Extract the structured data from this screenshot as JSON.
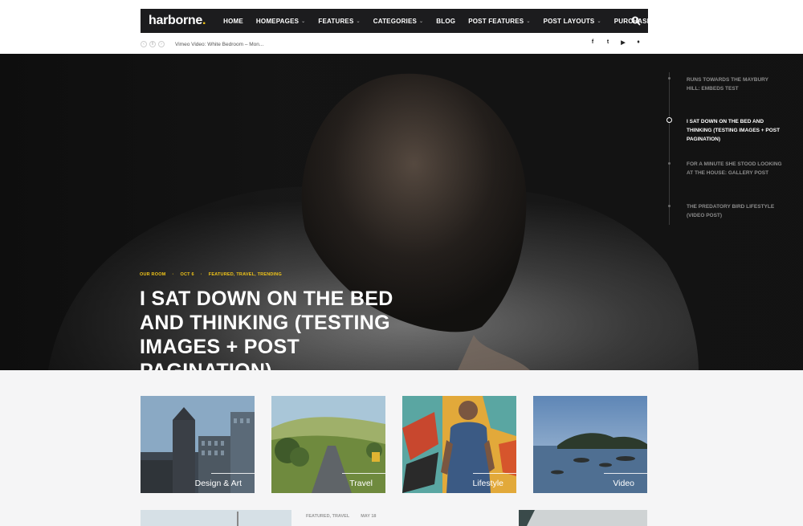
{
  "brand": {
    "name": "harborne",
    "dot": ".",
    "accent": "#f0c419"
  },
  "nav": {
    "items": [
      {
        "label": "HOME",
        "dropdown": false
      },
      {
        "label": "HOMEPAGES",
        "dropdown": true
      },
      {
        "label": "FEATURES",
        "dropdown": true
      },
      {
        "label": "CATEGORIES",
        "dropdown": true
      },
      {
        "label": "BLOG",
        "dropdown": false
      },
      {
        "label": "POST FEATURES",
        "dropdown": true
      },
      {
        "label": "POST LAYOUTS",
        "dropdown": true
      },
      {
        "label": "PURCHASE",
        "dropdown": false
      }
    ],
    "search_icon": "search-icon"
  },
  "ticker": {
    "text": "Vimeo Video: White Bedroom – Mon..."
  },
  "social": [
    "f",
    "t",
    "▶",
    "♦"
  ],
  "hero": {
    "meta": {
      "author": "OUR ROOM",
      "date": "OCT 6",
      "tags": "FEATURED, TRAVEL, TRENDING"
    },
    "title": "I SAT DOWN ON THE BED AND THINKING (TESTING IMAGES + POST PAGINATION)"
  },
  "side_posts": [
    {
      "title": "RUNS TOWARDS THE MAYBURY HILL: EMBEDS TEST",
      "active": false
    },
    {
      "title": "I SAT DOWN ON THE BED AND THINKING (TESTING IMAGES + POST PAGINATION)",
      "active": true
    },
    {
      "title": "FOR A MINUTE SHE STOOD LOOKING AT THE HOUSE: GALLERY POST",
      "active": false
    },
    {
      "title": "THE PREDATORY BIRD LIFESTYLE (VIDEO POST)",
      "active": false
    }
  ],
  "categories": [
    {
      "label": "Design & Art"
    },
    {
      "label": "Travel"
    },
    {
      "label": "Lifestyle"
    },
    {
      "label": "Video"
    }
  ],
  "bottom_post": {
    "tags": "FEATURED, TRAVEL",
    "date": "MAY 18"
  }
}
